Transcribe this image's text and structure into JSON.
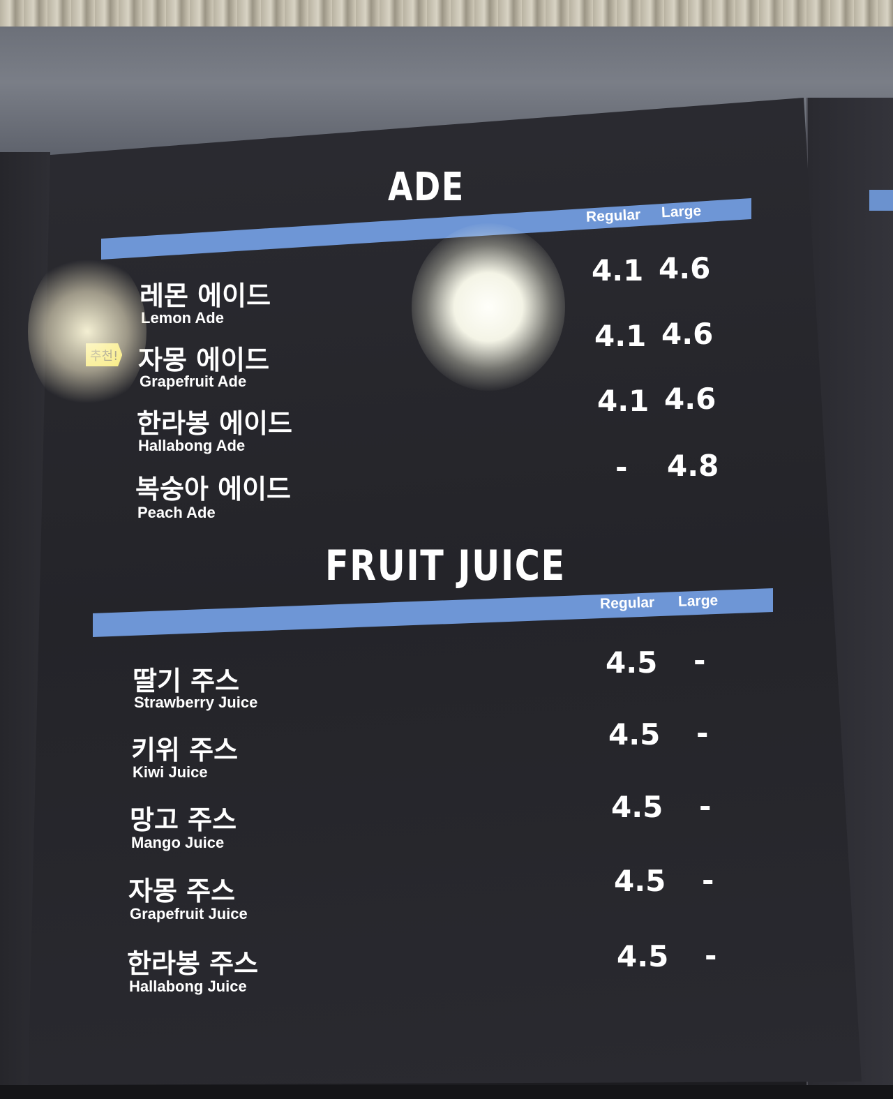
{
  "board": {
    "ade": {
      "title": "ADE",
      "regular_label": "Regular",
      "large_label": "Large",
      "recommended_tag": "추천!",
      "items": [
        {
          "ko": "레몬 에이드",
          "en": "Lemon Ade",
          "regular": "4.1",
          "large": "4.6"
        },
        {
          "ko": "자몽 에이드",
          "en": "Grapefruit Ade",
          "regular": "4.1",
          "large": "4.6"
        },
        {
          "ko": "한라봉 에이드",
          "en": "Hallabong Ade",
          "regular": "4.1",
          "large": "4.6"
        },
        {
          "ko": "복숭아 에이드",
          "en": "Peach Ade",
          "regular": "-",
          "large": "4.8"
        }
      ]
    },
    "juice": {
      "title": "FRUIT JUICE",
      "regular_label": "Regular",
      "large_label": "Large",
      "items": [
        {
          "ko": "딸기 주스",
          "en": "Strawberry Juice",
          "regular": "4.5",
          "large": "-"
        },
        {
          "ko": "키위 주스",
          "en": "Kiwi Juice",
          "regular": "4.5",
          "large": "-"
        },
        {
          "ko": "망고 주스",
          "en": "Mango Juice",
          "regular": "4.5",
          "large": "-"
        },
        {
          "ko": "자몽 주스",
          "en": "Grapefruit Juice",
          "regular": "4.5",
          "large": "-"
        },
        {
          "ko": "한라봉 주스",
          "en": "Hallabong Juice",
          "regular": "4.5",
          "large": "-"
        }
      ]
    }
  },
  "colors": {
    "band": "#6e96d6",
    "board": "#26262b",
    "tag": "#f2e64c"
  }
}
